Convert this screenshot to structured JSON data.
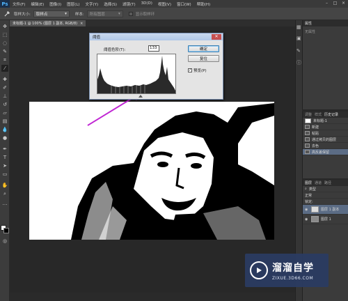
{
  "app": {
    "logo": "Ps"
  },
  "menu": [
    "文件(F)",
    "编辑(E)",
    "图像(I)",
    "图层(L)",
    "文字(Y)",
    "选择(S)",
    "滤镜(T)",
    "3D(D)",
    "视图(V)",
    "窗口(W)",
    "帮助(H)"
  ],
  "options": {
    "tool_icon": "eyedropper-icon",
    "sample_size_label": "取样大小:",
    "sample_size_value": "取样点",
    "sample_label": "样本:",
    "sample_value": "所有图层",
    "show_ring_label": "显示取样环"
  },
  "document": {
    "tab_title": "未标题-1 @ 100% (图层 1 副本, RGB/8)",
    "close": "×"
  },
  "dialog": {
    "title": "阈值",
    "threshold_label": "阈值色阶(T):",
    "threshold_value": "133",
    "ok_label": "确定",
    "reset_label": "复位",
    "preview_label": "预览(P)",
    "preview_checked": true,
    "close_icon": "close-icon"
  },
  "panels": {
    "properties": {
      "tabs": [
        "属性"
      ],
      "empty_text": "无属性"
    },
    "history": {
      "tabs": [
        "调整",
        "样式",
        "历史记录"
      ],
      "items": [
        "未标题-1",
        "新建",
        "粘贴",
        "通过拷贝的图层",
        "去色",
        "高反差保留"
      ]
    },
    "layers": {
      "tabs": [
        "图层",
        "通道",
        "路径"
      ],
      "kind_label": "类型",
      "blend_mode": "正常",
      "lock_label": "锁定:",
      "layers": [
        {
          "name": "图层 1 副本"
        },
        {
          "name": "图层 1"
        }
      ]
    }
  },
  "watermark": {
    "title": "溜溜自学",
    "url": "ZIXUE.3D66.COM"
  },
  "colors": {
    "annotation_arrow": "#c026d3",
    "accent": "#5b6c85"
  }
}
